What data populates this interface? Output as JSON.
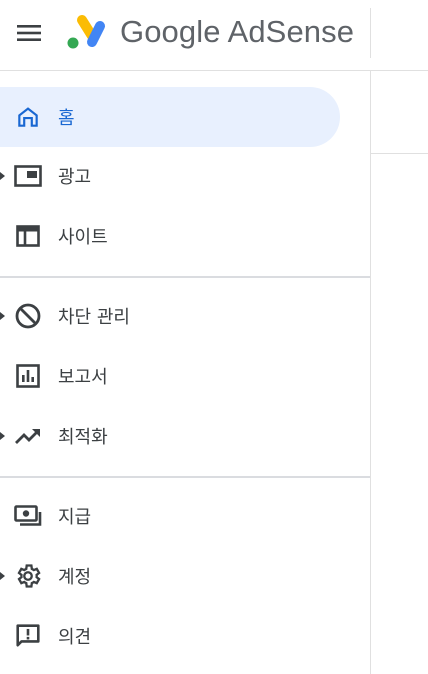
{
  "header": {
    "brand": "Google AdSense"
  },
  "colors": {
    "active_bg": "#e8f0fe",
    "active_fg": "#1967d2",
    "text": "#3c4043",
    "logo_yellow": "#fbbc04",
    "logo_blue": "#4285f4",
    "logo_green": "#34a853"
  },
  "nav": {
    "items": [
      {
        "label": "홈",
        "icon": "home-icon",
        "active": true,
        "expandable": false
      },
      {
        "label": "광고",
        "icon": "ads-icon",
        "active": false,
        "expandable": true
      },
      {
        "label": "사이트",
        "icon": "sites-icon",
        "active": false,
        "expandable": false
      },
      {
        "label": "차단 관리",
        "icon": "block-icon",
        "active": false,
        "expandable": true
      },
      {
        "label": "보고서",
        "icon": "reports-icon",
        "active": false,
        "expandable": false
      },
      {
        "label": "최적화",
        "icon": "trending-up-icon",
        "active": false,
        "expandable": true
      },
      {
        "label": "지급",
        "icon": "payments-icon",
        "active": false,
        "expandable": false
      },
      {
        "label": "계정",
        "icon": "gear-icon",
        "active": false,
        "expandable": true
      },
      {
        "label": "의견",
        "icon": "feedback-icon",
        "active": false,
        "expandable": false
      }
    ]
  }
}
